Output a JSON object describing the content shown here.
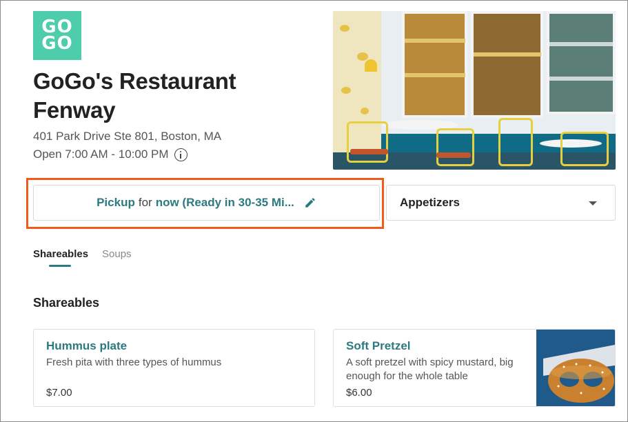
{
  "restaurant": {
    "logo_line1": "GO",
    "logo_line2": "GO",
    "name": "GoGo's Restaurant Fenway",
    "address": "401 Park Drive Ste 801, Boston, MA",
    "hours": "Open 7:00 AM - 10:00 PM"
  },
  "fulfillment": {
    "mode": "Pickup",
    "connector": "for",
    "time": "now (Ready in 30-35 Mi..."
  },
  "category_select": {
    "selected": "Appetizers"
  },
  "tabs": [
    {
      "label": "Shareables",
      "active": true
    },
    {
      "label": "Soups",
      "active": false
    }
  ],
  "section": {
    "title": "Shareables"
  },
  "items": [
    {
      "name": "Hummus plate",
      "description": "Fresh pita with three types of hummus",
      "price": "$7.00"
    },
    {
      "name": "Soft Pretzel",
      "description": "A soft pretzel with spicy mustard, big enough for the whole table",
      "price": "$6.00"
    }
  ],
  "colors": {
    "brand_teal": "#2a7a7f",
    "logo_green": "#4ecdad",
    "highlight": "#f05a1a"
  }
}
